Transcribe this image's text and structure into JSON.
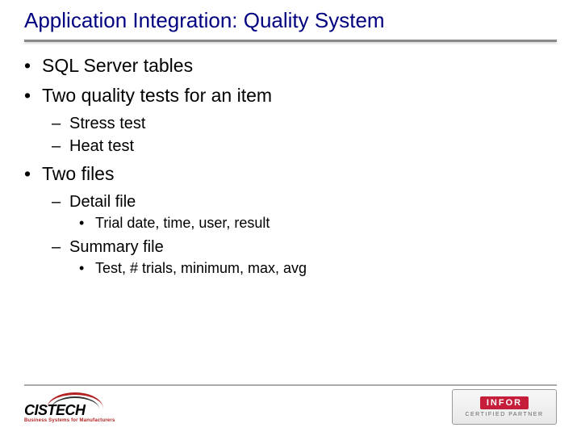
{
  "title": "Application Integration: Quality System",
  "bullets": {
    "b1": "SQL Server tables",
    "b2": "Two quality tests for an item",
    "b2_1": "Stress test",
    "b2_2": "Heat test",
    "b3": "Two files",
    "b3_1": "Detail file",
    "b3_1_1": "Trial date, time, user, result",
    "b3_2": "Summary file",
    "b3_2_1": "Test, # trials, minimum, max, avg"
  },
  "logo_left": {
    "name": "CISTECH",
    "tagline": "Business Systems for Manufacturers"
  },
  "logo_right": {
    "brand": "INFOR",
    "label": "CERTIFIED PARTNER"
  }
}
